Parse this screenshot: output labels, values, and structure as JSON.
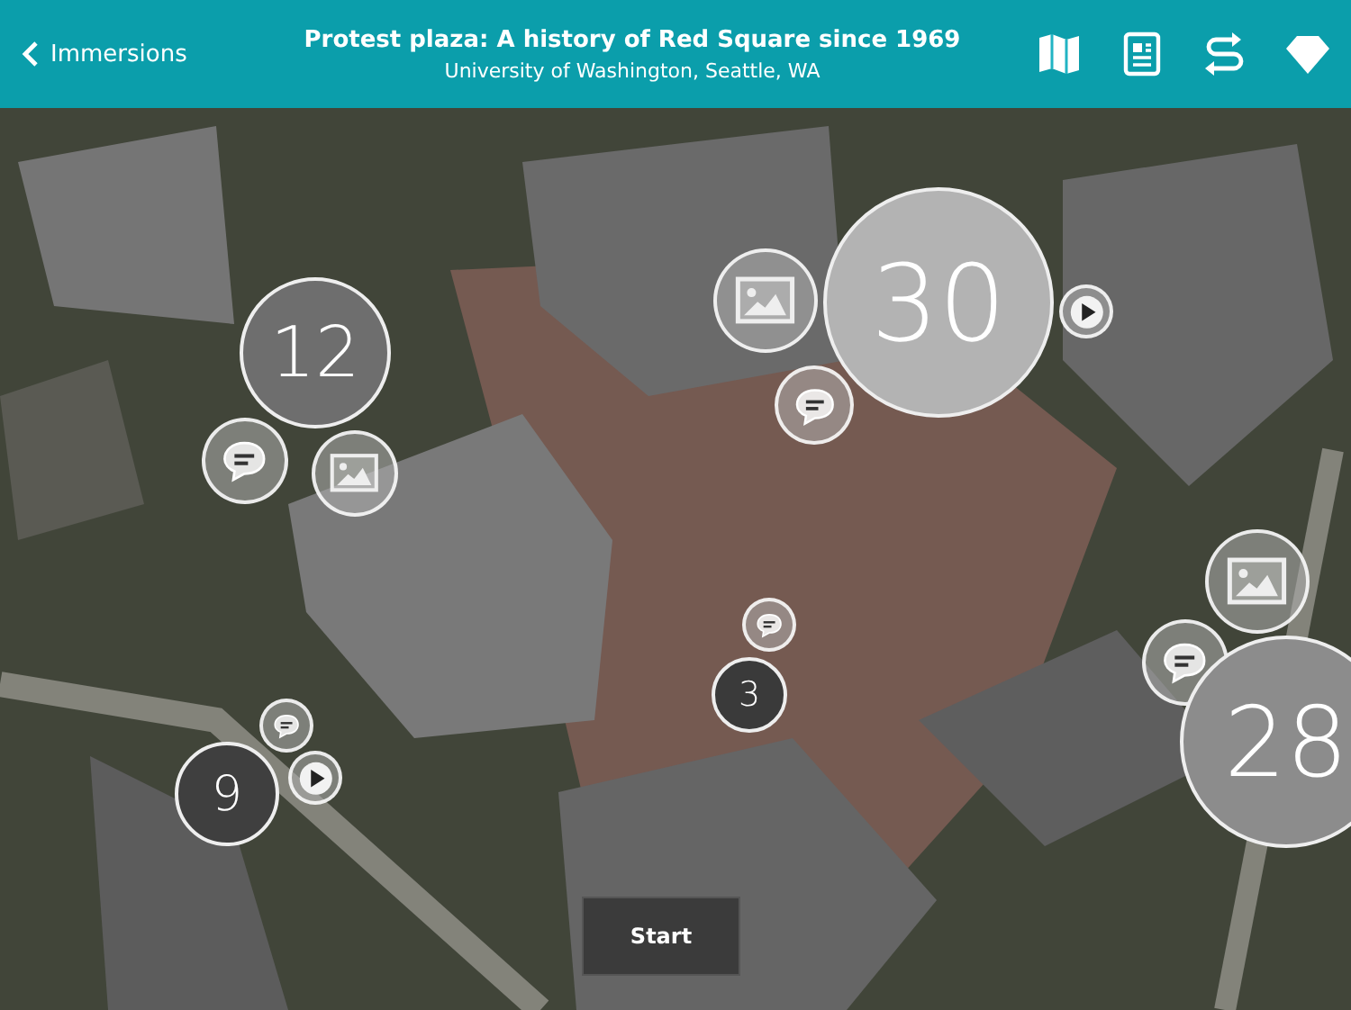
{
  "header": {
    "back": "Immersions",
    "title": "Protest plaza: A history of Red Square since 1969",
    "subtitle": "University of Washington, Seattle, WA"
  },
  "markers": [
    {
      "kind": "cluster",
      "count": "12",
      "color": "#6e6e6e"
    },
    {
      "kind": "comment"
    },
    {
      "kind": "image"
    },
    {
      "kind": "cluster",
      "count": "30",
      "color": "#b3b3b3"
    },
    {
      "kind": "image"
    },
    {
      "kind": "comment"
    },
    {
      "kind": "video"
    },
    {
      "kind": "image"
    },
    {
      "kind": "comment"
    },
    {
      "kind": "cluster",
      "count": "28",
      "color": "#8c8c8c"
    },
    {
      "kind": "comment"
    },
    {
      "kind": "cluster",
      "count": "3",
      "color": "#3a3a3a"
    },
    {
      "kind": "comment"
    },
    {
      "kind": "video"
    },
    {
      "kind": "cluster",
      "count": "9",
      "color": "#3f3f3f"
    }
  ],
  "start_button": "Start"
}
